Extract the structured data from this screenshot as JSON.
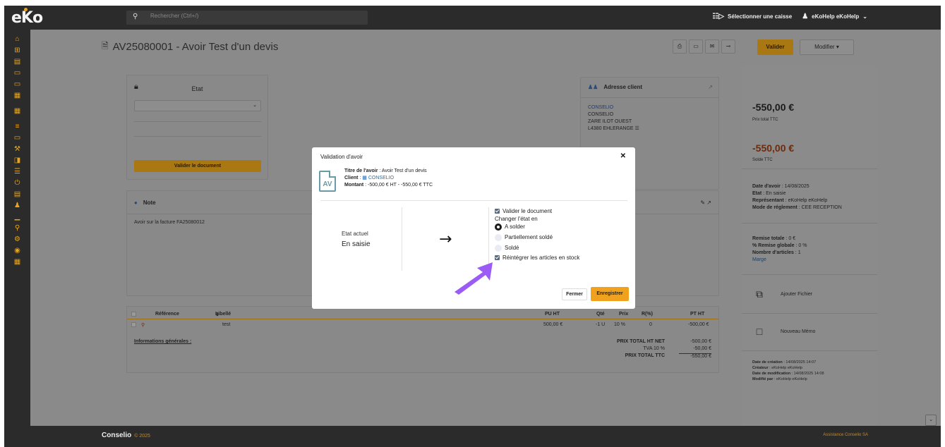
{
  "topbar": {
    "logo": "eKo",
    "search_placeholder": "Rechercher (Ctrl+/)",
    "select_cashier": "Sélectionner une caisse",
    "user": "eKoHelp eKoHelp"
  },
  "page": {
    "title": "AV25080001 - Avoir Test d'un devis",
    "btn_valider": "Valider",
    "btn_modifier": "Modifier"
  },
  "etat_card": {
    "title": "Etat",
    "btn_validate": "Valider le document"
  },
  "note_card": {
    "title": "Note",
    "text": "Avoir sur la facture FA25080012"
  },
  "address_card": {
    "title": "Adresse client",
    "link": "CONSELIO",
    "line1": "CONSELIO",
    "line2": "ZARE ILOT OUEST",
    "line3": "L4380 EHLERANGE"
  },
  "table": {
    "headers": [
      "Référence",
      "Libellé",
      "PU HT",
      "Qté",
      "Prix",
      "R(%)",
      "PT HT"
    ],
    "row": {
      "ref": "",
      "libelle": "test",
      "pu": "500,00 €",
      "qte": "-1 U",
      "tva": "10 %",
      "r": "0",
      "pt": "-500,00 €"
    },
    "info_label": "Informations générales :",
    "totals": [
      {
        "k": "PRIX TOTAL HT NET",
        "v": "-500,00 €"
      },
      {
        "k": "TVA 10 %",
        "v": "-50,00 €"
      },
      {
        "k": "PRIX TOTAL TTC",
        "v": "-550,00 €"
      }
    ]
  },
  "right_panel": {
    "total_ttc": "-550,00 €",
    "total_ttc_label": "Prix total TTC",
    "solde": "-550,00 €",
    "solde_label": "Solde TTC",
    "date_avoir_k": "Date d'avoir",
    "date_avoir_v": " : 14/08/2025",
    "etat_k": "Etat",
    "etat_v": " : En saisie",
    "rep_k": "Représentant",
    "rep_v": " : eKoHelp eKoHelp",
    "mode_k": "Mode de réglement",
    "mode_v": " : CEE RECEPTION",
    "remise_k": "Remise totale",
    "remise_v": " : 0 €",
    "remise_g_k": "% Remise globale",
    "remise_g_v": " : 0 %",
    "nb_k": "Nombre d'articles",
    "nb_v": " : 1",
    "marge": "Marge",
    "add_file": "Ajouter Fichier",
    "new_memo": "Nouveau Mémo",
    "creation_k": "Date de création",
    "creation_v": " : 14/08/2025 14:07",
    "createur_k": "Créateur",
    "createur_v": " : eKoHelp eKoHelp",
    "modif_k": "Date de modification",
    "modif_v": " : 14/08/2025 14:08",
    "modif_par_k": "Modifié par",
    "modif_par_v": " : eKoHelp eKoHelp"
  },
  "footer": {
    "brand": "Conselio",
    "year": "© 2025",
    "right": "Assistance Conselio SA"
  },
  "modal": {
    "title": "Validation d'avoir",
    "icon_text": "AV",
    "titre_k": "Titre de l'avoir",
    "titre_v": " : Avoir Test d'un devis",
    "client_k": "Client",
    "client_v": "CONSELIO",
    "montant_k": "Montant",
    "montant_v": " : -500,00 € HT - -550,00 € TTC",
    "etat_actuel_label": "Etat actuel",
    "etat_actuel_value": "En saisie",
    "opt_valider": "Valider le document",
    "change_label": "Changer l'état en",
    "radio_a_solder": "A solder",
    "radio_partiel": "Partiellement soldé",
    "radio_solde": "Soldé",
    "opt_reintegrer": "Réintégrer les articles en stock",
    "btn_fermer": "Fermer",
    "btn_enregistrer": "Enregistrer"
  }
}
